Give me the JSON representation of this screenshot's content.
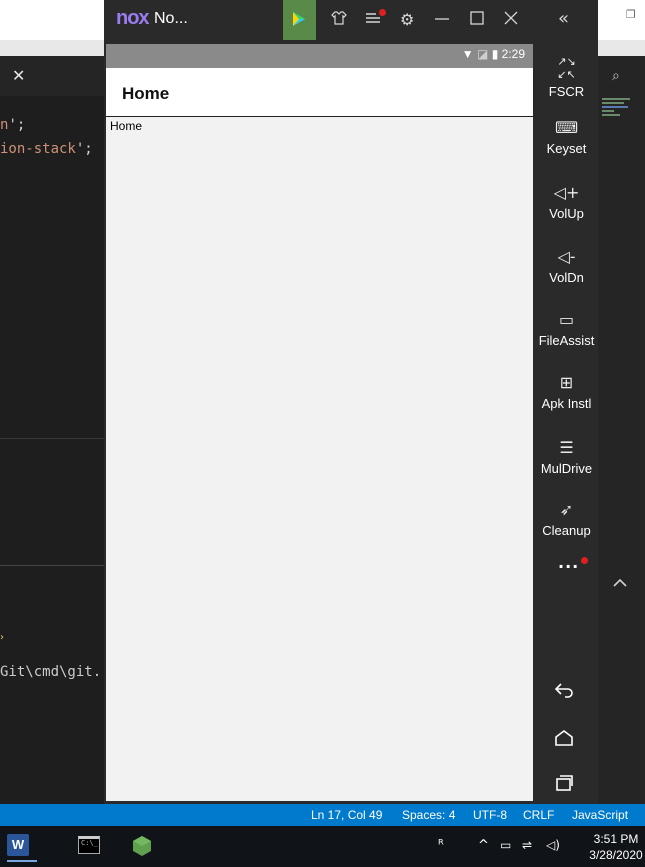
{
  "emulator": {
    "logo": "nox",
    "title": "No...",
    "title_icons": [
      "play-store-icon",
      "theme-icon",
      "menu-icon",
      "settings-icon",
      "minimize-icon",
      "maximize-icon",
      "close-icon"
    ],
    "status_bar": {
      "time": "2:29",
      "icons": [
        "wifi-icon",
        "no-signal-icon",
        "battery-icon"
      ]
    },
    "app": {
      "header_title": "Home",
      "body_text": "Home"
    },
    "sidebar": {
      "items": [
        {
          "label": "FSCR",
          "icon": "fullscreen-icon"
        },
        {
          "label": "Keyset",
          "icon": "keyboard-icon"
        },
        {
          "label": "VolUp",
          "icon": "volume-up-icon"
        },
        {
          "label": "VolDn",
          "icon": "volume-down-icon"
        },
        {
          "label": "FileAssist",
          "icon": "file-assist-icon"
        },
        {
          "label": "Apk Instl",
          "icon": "apk-install-icon"
        },
        {
          "label": "MulDrive",
          "icon": "multi-drive-icon"
        },
        {
          "label": "Cleanup",
          "icon": "rocket-icon"
        }
      ],
      "more": "...",
      "nav": [
        "back-icon",
        "home-icon",
        "recents-icon"
      ]
    },
    "accent": "#e02020"
  },
  "editor": {
    "code_lines": [
      {
        "text": "n",
        "punct": "';"
      },
      {
        "text": "ion-stack",
        "punct": "';"
      }
    ],
    "terminal_line": "Git\\cmd\\git.",
    "status": {
      "position": "Ln 17, Col 49",
      "spaces": "Spaces: 4",
      "encoding": "UTF-8",
      "eol": "CRLF",
      "language": "JavaScript"
    },
    "status_color": "#007acc"
  },
  "taskbar": {
    "word_letter": "W",
    "time": "3:51 PM",
    "date": "3/28/2020"
  }
}
